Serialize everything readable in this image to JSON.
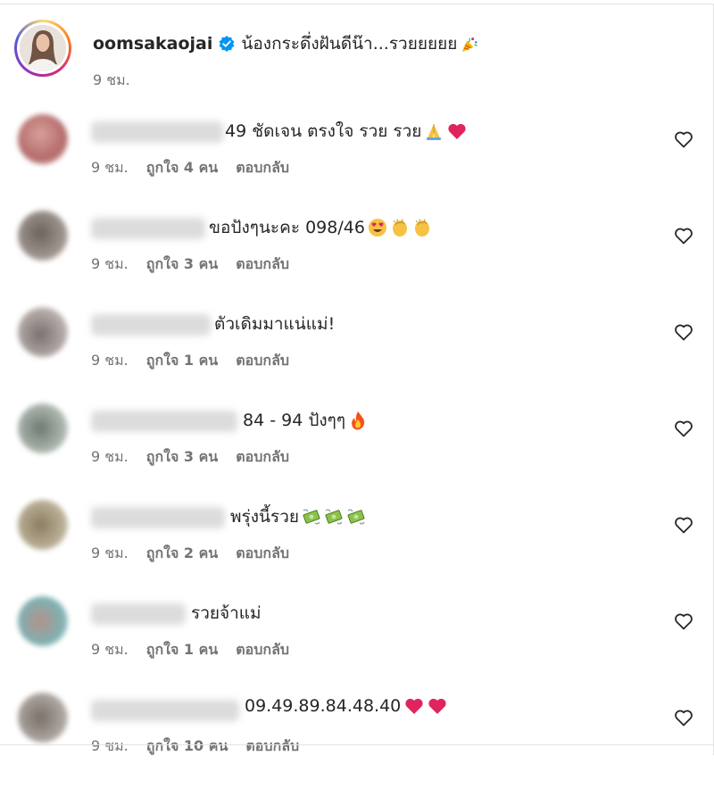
{
  "post": {
    "username": "oomsakaojai",
    "caption": "น้องกระดึ่งฝันดีน๊า...รวยยยยย",
    "time": "9 ชม."
  },
  "comments": [
    {
      "text": "49 ชัดเจน ตรงใจ รวย รวย",
      "emojis": [
        "folded-hands",
        "red-heart"
      ],
      "time": "9 ชม.",
      "likes": "ถูกใจ 4 คน",
      "reply": "ตอบกลับ",
      "avatar_color": "#c98a8a"
    },
    {
      "text": "ขอปังๆนะคะ 098/46",
      "emojis": [
        "heart-eyes",
        "clap",
        "clap"
      ],
      "time": "9 ชม.",
      "likes": "ถูกใจ 3 คน",
      "reply": "ตอบกลับ",
      "avatar_color": "#8a7f78"
    },
    {
      "text": "ตัวเดิมมาแน่แม่!",
      "emojis": [],
      "time": "9 ชม.",
      "likes": "ถูกใจ 1 คน",
      "reply": "ตอบกลับ",
      "avatar_color": "#9a8f8c"
    },
    {
      "text": "84 - 94 ปังๆๆ",
      "emojis": [
        "fire"
      ],
      "time": "9 ชม.",
      "likes": "ถูกใจ 3 คน",
      "reply": "ตอบกลับ",
      "avatar_color": "#8f9b93"
    },
    {
      "text": "พรุ่งนี้รวย",
      "emojis": [
        "money",
        "money",
        "money"
      ],
      "time": "9 ชม.",
      "likes": "ถูกใจ 2 คน",
      "reply": "ตอบกลับ",
      "avatar_color": "#8f8570"
    },
    {
      "text": "รวยจ้าแม่",
      "emojis": [],
      "time": "9 ชม.",
      "likes": "ถูกใจ 1 คน",
      "reply": "ตอบกลับ",
      "avatar_color": "#7fa6a8"
    },
    {
      "text": "09.49.89.84.48.40",
      "emojis": [
        "red-heart",
        "red-heart"
      ],
      "time": "9 ชม.",
      "likes": "ถูกใจ 10 คน",
      "reply": "ตอบกลับ",
      "avatar_color": "#8a8480"
    }
  ],
  "colors": {
    "secondary_text": "#737373",
    "verified": "#0095f6",
    "heart_red": "#e0245e"
  }
}
